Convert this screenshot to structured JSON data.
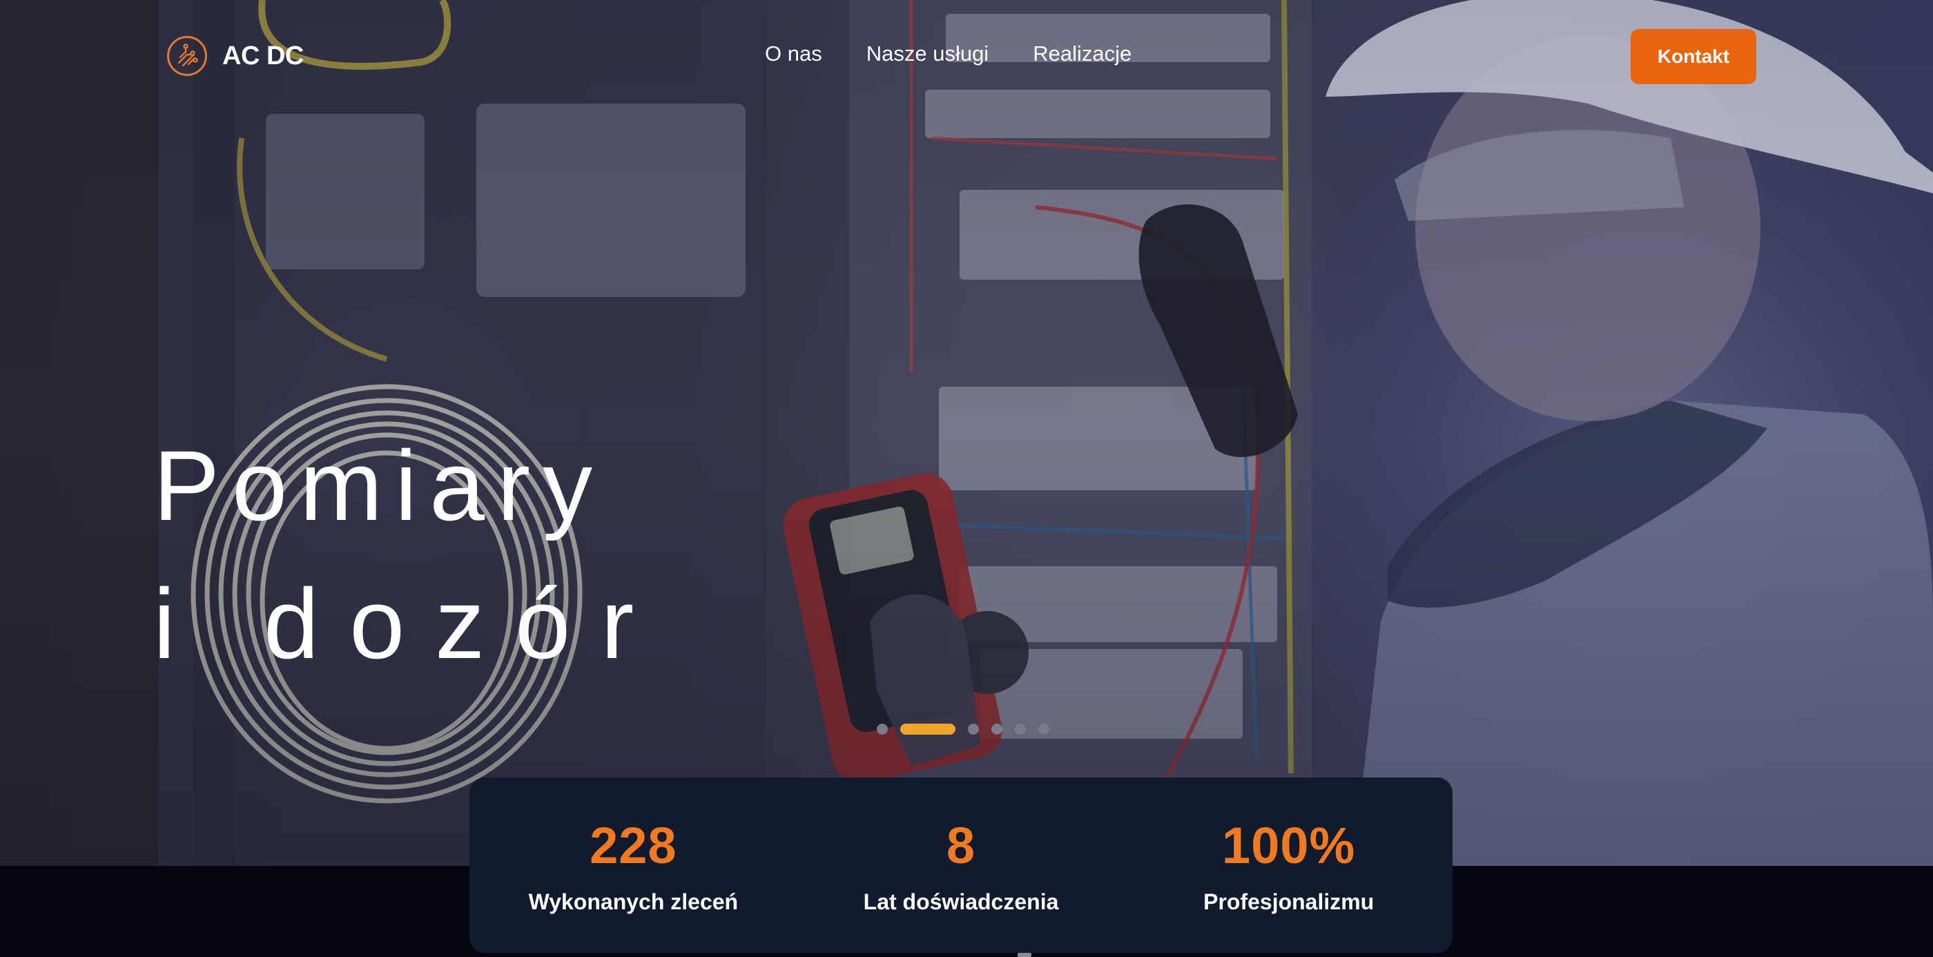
{
  "brand": {
    "name": "AC DC",
    "logo_icon": "circuit-logo-icon",
    "accent": "#e8640f"
  },
  "nav": {
    "links": [
      {
        "label": "O nas"
      },
      {
        "label": "Nasze usługi"
      },
      {
        "label": "Realizacje"
      }
    ],
    "cta_label": "Kontakt"
  },
  "hero": {
    "headline_line1": "Pomiary",
    "headline_line2": "i dozór",
    "slider": {
      "count": 6,
      "active_index": 1,
      "active_color": "#f0a52a"
    }
  },
  "stats": [
    {
      "value": "228",
      "label": "Wykonanych zleceń"
    },
    {
      "value": "8",
      "label": "Lat doświadczenia"
    },
    {
      "value": "100%",
      "label": "Profesjonalizmu"
    }
  ]
}
